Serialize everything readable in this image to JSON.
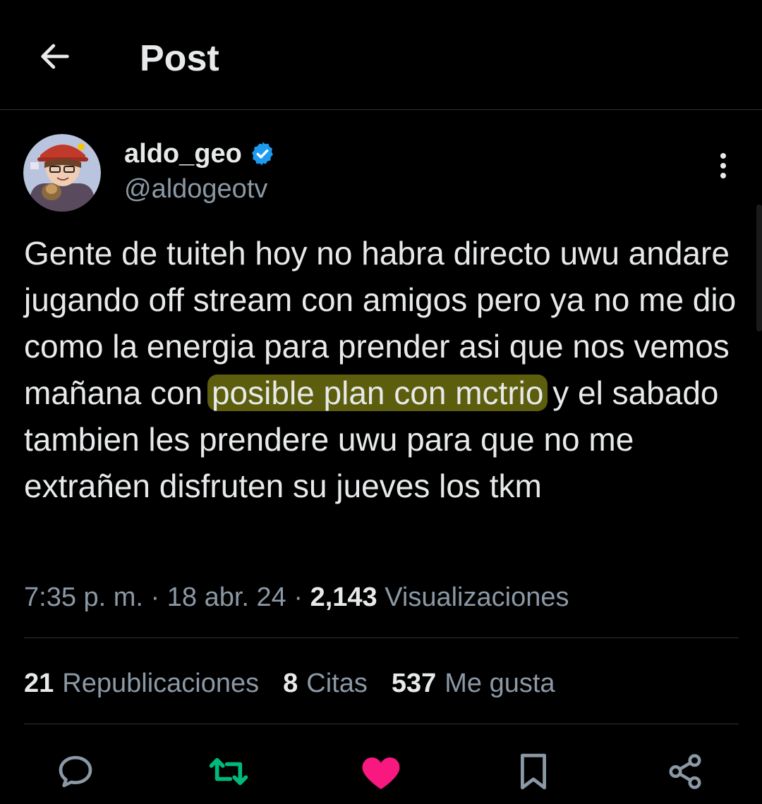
{
  "header": {
    "title": "Post",
    "back_icon": "arrow-left-icon"
  },
  "author": {
    "display_name": "aldo_geo",
    "handle": "@aldogeotv",
    "verified": true,
    "verified_color": "#1d9bf0"
  },
  "post": {
    "text_before": "Gente de tuiteh hoy no habra directo uwu andare jugando off stream con amigos pero ya no me dio como la energia para prender asi que nos vemos mañana con ",
    "text_highlight": "posible plan con mctrio",
    "text_after": " y el sabado tambien les prendere uwu para que no me extrañen disfruten su jueves los tkm",
    "highlight_color": "#dce01e"
  },
  "meta": {
    "time": "7:35 p. m.",
    "separator": "·",
    "date": "18 abr. 24",
    "views_count": "2,143",
    "views_label": "Visualizaciones"
  },
  "stats": {
    "reposts_count": "21",
    "reposts_label": "Republicaciones",
    "quotes_count": "8",
    "quotes_label": "Citas",
    "likes_count": "537",
    "likes_label": "Me gusta"
  },
  "actions": {
    "reply_icon": "reply-icon",
    "repost_icon": "repost-icon",
    "repost_color": "#00ba7c",
    "like_icon": "heart-icon",
    "like_color": "#f91880",
    "bookmark_icon": "bookmark-icon",
    "share_icon": "share-icon"
  }
}
